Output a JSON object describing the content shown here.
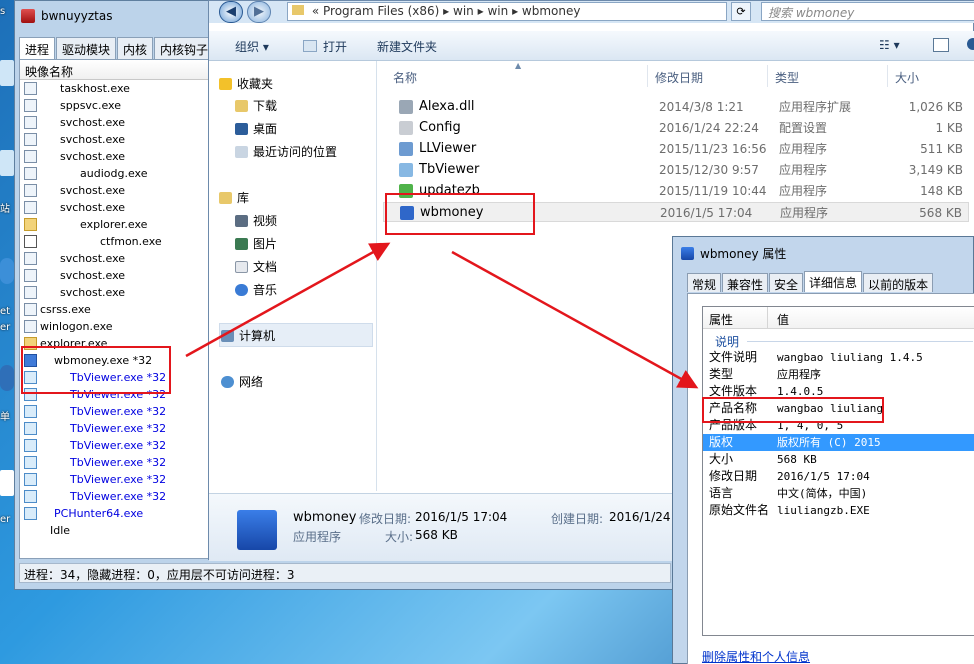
{
  "desktop": {
    "labels": [
      "s",
      "站",
      "et",
      "er",
      "单",
      "er"
    ]
  },
  "hunter": {
    "title": "bwnuyyztas",
    "tabs": [
      "进程",
      "驱动模块",
      "内核",
      "内核钩子"
    ],
    "column_header": "映像名称",
    "processes": [
      {
        "name": "taskhost.exe",
        "indent": 1,
        "icon": "process-icon",
        "blue": false
      },
      {
        "name": "sppsvc.exe",
        "indent": 1,
        "icon": "process-icon",
        "blue": false
      },
      {
        "name": "svchost.exe",
        "indent": 1,
        "icon": "process-icon",
        "blue": false
      },
      {
        "name": "svchost.exe",
        "indent": 1,
        "icon": "process-icon",
        "blue": false
      },
      {
        "name": "svchost.exe",
        "indent": 1,
        "icon": "process-icon",
        "blue": false
      },
      {
        "name": "audiodg.exe",
        "indent": 2,
        "icon": "process-icon",
        "blue": false
      },
      {
        "name": "svchost.exe",
        "indent": 1,
        "icon": "process-icon",
        "blue": false
      },
      {
        "name": "svchost.exe",
        "indent": 1,
        "icon": "process-icon",
        "blue": false
      },
      {
        "name": "explorer.exe",
        "indent": 2,
        "icon": "folder-icon",
        "blue": false
      },
      {
        "name": "ctfmon.exe",
        "indent": 3,
        "icon": "pen-icon",
        "blue": false
      },
      {
        "name": "svchost.exe",
        "indent": 1,
        "icon": "process-icon",
        "blue": false
      },
      {
        "name": "svchost.exe",
        "indent": 1,
        "icon": "process-icon",
        "blue": false
      },
      {
        "name": "svchost.exe",
        "indent": 1,
        "icon": "process-icon",
        "blue": false
      },
      {
        "name": "csrss.exe",
        "indent": 0,
        "icon": "process-icon",
        "blue": false
      },
      {
        "name": "winlogon.exe",
        "indent": 0,
        "icon": "process-icon",
        "blue": false
      },
      {
        "name": "explorer.exe",
        "indent": 0,
        "icon": "folder-icon",
        "blue": false
      },
      {
        "name": "wbmoney.exe *32",
        "indent": 0.7,
        "icon": "wbmoney-icon",
        "blue": false
      },
      {
        "name": "TbViewer.exe *32",
        "indent": 1.5,
        "icon": "tbviewer-icon",
        "blue": true
      },
      {
        "name": "TbViewer.exe *32",
        "indent": 1.5,
        "icon": "tbviewer-icon",
        "blue": true
      },
      {
        "name": "TbViewer.exe *32",
        "indent": 1.5,
        "icon": "tbviewer-icon",
        "blue": true
      },
      {
        "name": "TbViewer.exe *32",
        "indent": 1.5,
        "icon": "tbviewer-icon",
        "blue": true
      },
      {
        "name": "TbViewer.exe *32",
        "indent": 1.5,
        "icon": "tbviewer-icon",
        "blue": true
      },
      {
        "name": "TbViewer.exe *32",
        "indent": 1.5,
        "icon": "tbviewer-icon",
        "blue": true
      },
      {
        "name": "TbViewer.exe *32",
        "indent": 1.5,
        "icon": "tbviewer-icon",
        "blue": true
      },
      {
        "name": "TbViewer.exe *32",
        "indent": 1.5,
        "icon": "tbviewer-icon",
        "blue": true
      },
      {
        "name": "PCHunter64.exe",
        "indent": 0.7,
        "icon": "pchunter-icon",
        "blue": true
      },
      {
        "name": "Idle",
        "indent": 0.5,
        "icon": "none",
        "blue": false
      }
    ],
    "status": "进程：34，隐藏进程：0，应用层不可访问进程：3"
  },
  "explorer": {
    "address_prefix": "«",
    "breadcrumb": [
      "Program Files (x86)",
      "win",
      "win",
      "wbmoney"
    ],
    "breadcrumb_sep": "▸",
    "search_placeholder": "搜索 wbmoney",
    "toolbar": {
      "organize": "组织 ▾",
      "open": "打开",
      "new_folder": "新建文件夹"
    },
    "nav": {
      "favorites": "收藏夹",
      "downloads": "下载",
      "desktop": "桌面",
      "recent": "最近访问的位置",
      "libraries": "库",
      "videos": "视频",
      "pictures": "图片",
      "documents": "文档",
      "music": "音乐",
      "computer": "计算机",
      "network": "网络"
    },
    "columns": {
      "name": "名称",
      "date": "修改日期",
      "type": "类型",
      "size": "大小"
    },
    "files": [
      {
        "name": "Alexa.dll",
        "date": "2014/3/8 1:21",
        "type": "应用程序扩展",
        "size": "1,026 KB",
        "icon": "dll-icon",
        "color": "#9aa7b5"
      },
      {
        "name": "Config",
        "date": "2016/1/24 22:24",
        "type": "配置设置",
        "size": "1 KB",
        "icon": "config-icon",
        "color": "#c9cdd3"
      },
      {
        "name": "LLViewer",
        "date": "2015/11/23 16:56",
        "type": "应用程序",
        "size": "511 KB",
        "icon": "llviewer-icon",
        "color": "#6d9bd1"
      },
      {
        "name": "TbViewer",
        "date": "2015/12/30 9:57",
        "type": "应用程序",
        "size": "3,149 KB",
        "icon": "tbviewer-icon",
        "color": "#87b8e3"
      },
      {
        "name": "updatezb",
        "date": "2015/11/19 10:44",
        "type": "应用程序",
        "size": "148 KB",
        "icon": "updatezb-icon",
        "color": "#4fb34a"
      },
      {
        "name": "wbmoney",
        "date": "2016/1/5 17:04",
        "type": "应用程序",
        "size": "568 KB",
        "icon": "wbmoney-icon",
        "color": "#2f67c9"
      }
    ],
    "details": {
      "name": "wbmoney",
      "modified_label": "修改日期:",
      "modified": "2016/1/5 17:04",
      "created_label": "创建日期:",
      "created": "2016/1/24",
      "kind": "应用程序",
      "size_label": "大小:",
      "size": "568 KB"
    }
  },
  "props": {
    "title": "wbmoney 属性",
    "tabs": [
      "常规",
      "兼容性",
      "安全",
      "详细信息",
      "以前的版本"
    ],
    "active_tab": 3,
    "head_property": "属性",
    "head_value": "值",
    "section": "说明",
    "rows": [
      {
        "k": "文件说明",
        "v": "wangbao liuliang 1.4.5"
      },
      {
        "k": "类型",
        "v": "应用程序"
      },
      {
        "k": "文件版本",
        "v": "1.4.0.5"
      },
      {
        "k": "产品名称",
        "v": "wangbao liuliang"
      },
      {
        "k": "产品版本",
        "v": "1, 4, 0, 5"
      },
      {
        "k": "版权",
        "v": "版权所有 (C) 2015"
      },
      {
        "k": "大小",
        "v": "568 KB"
      },
      {
        "k": "修改日期",
        "v": "2016/1/5 17:04"
      },
      {
        "k": "语言",
        "v": "中文(简体，中国)"
      },
      {
        "k": "原始文件名",
        "v": "liuliangzb.EXE"
      }
    ],
    "highlight_row": 5,
    "link": "删除属性和个人信息"
  },
  "colors": {
    "annotation_red": "#e3161c",
    "selection_blue": "#3399ff",
    "link_blue": "#0033cc"
  }
}
